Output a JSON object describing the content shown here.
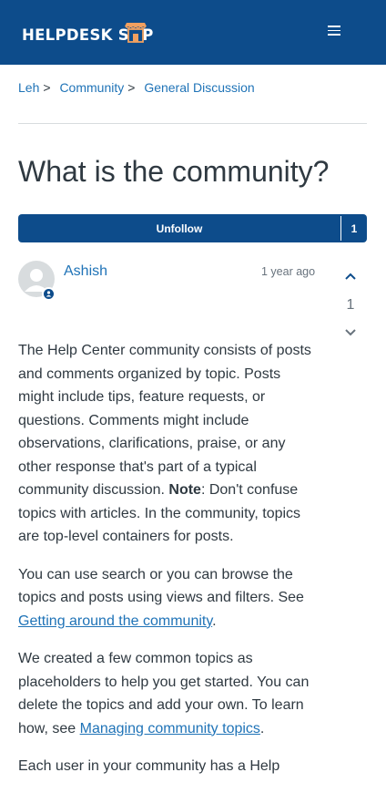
{
  "header": {
    "logo_left": "HELPDESK S",
    "logo_o": "O",
    "logo_right": "P"
  },
  "breadcrumb": [
    {
      "label": "Leh"
    },
    {
      "label": "Community"
    },
    {
      "label": "General Discussion"
    }
  ],
  "breadcrumb_separator": ">",
  "post": {
    "title": "What is the community?",
    "follow_label": "Unfollow",
    "follow_count": "1",
    "author": "Ashish",
    "time": "1 year ago",
    "vote_count": "1",
    "p1a": "The Help Center community consists of posts and comments organized by topic. Posts might include tips, feature requests, or questions. Comments might include observations, clarifications, praise, or any other response that's part of a typical community discussion. ",
    "p1_bold": "Note",
    "p1b": ": Don't confuse topics with articles. In the community, topics are top-level containers for posts.",
    "p2a": "You can use search or you can browse the topics and posts using views and filters. See ",
    "p2_link": "Getting around the community",
    "p2b": ".",
    "p3a": "We created a few common topics as placeholders to help you get started. You can delete the topics and add your own. To learn how, see ",
    "p3_link": "Managing community topics",
    "p3b": ".",
    "p4": "Each user in your community has a Help"
  },
  "colors": {
    "brand": "#0d4c8b",
    "link": "#1f73b7",
    "text": "#2f3941",
    "muted": "#68737d"
  },
  "icons": {
    "menu": "hamburger-icon",
    "avatar": "user-silhouette-icon",
    "upvote": "chevron-up-icon",
    "downvote": "chevron-down-icon"
  }
}
